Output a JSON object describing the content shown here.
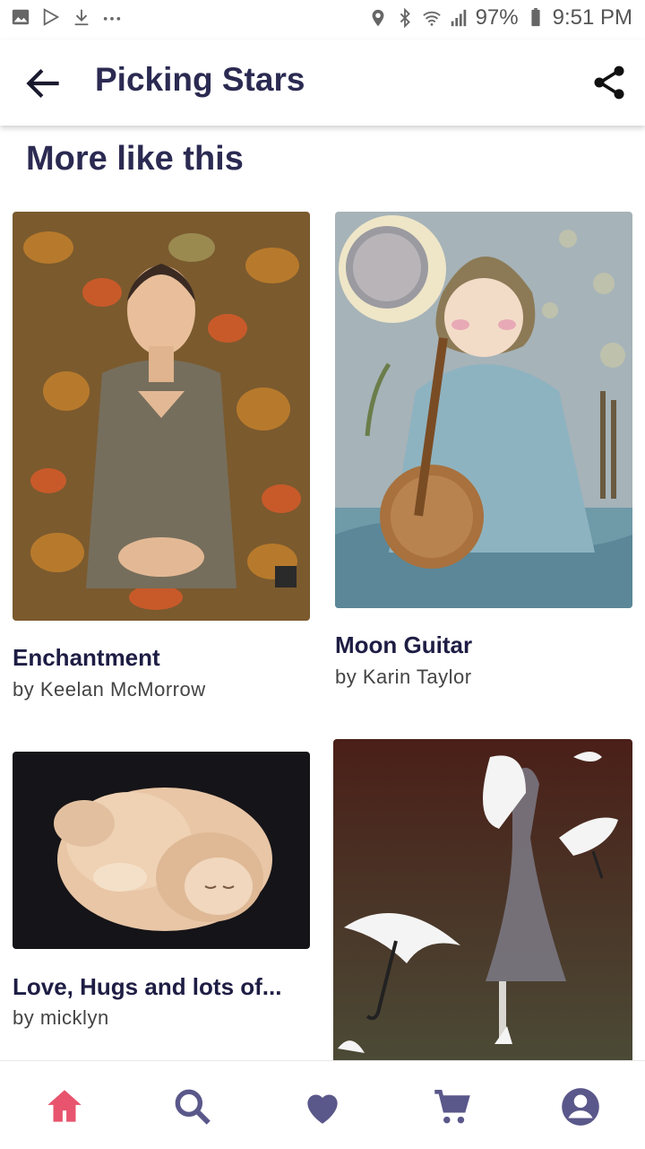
{
  "status_bar": {
    "battery": "97%",
    "time": "9:51 PM",
    "icons": [
      "image-icon",
      "play-store-icon",
      "download-icon",
      "more-dots-icon",
      "location-icon",
      "bluetooth-icon",
      "wifi-icon",
      "signal-icon",
      "battery-icon"
    ]
  },
  "app_bar": {
    "title": "Picking Stars",
    "back_icon": "arrow-back-icon",
    "share_icon": "share-icon"
  },
  "section": {
    "title": "More like this"
  },
  "artworks": [
    {
      "title": "Enchantment",
      "artist": "by Keelan McMorrow"
    },
    {
      "title": "Moon Guitar",
      "artist": "by Karin Taylor"
    },
    {
      "title": "Love, Hugs and lots of...",
      "artist": "by micklyn"
    },
    {
      "title": "",
      "artist": ""
    }
  ],
  "bottom_nav": {
    "items": [
      "home-icon",
      "search-icon",
      "favorites-icon",
      "cart-icon",
      "account-icon"
    ],
    "active_color": "#e8546e",
    "inactive_color": "#5a578a"
  }
}
